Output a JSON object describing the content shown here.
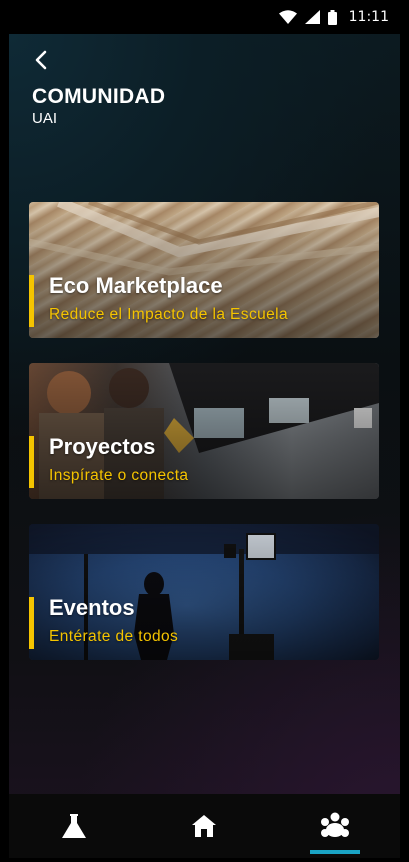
{
  "status_bar": {
    "time": "11:11",
    "icons": [
      "wifi-icon",
      "signal-icon",
      "battery-icon"
    ]
  },
  "header": {
    "title": "COMUNIDAD",
    "subtitle": "UAI",
    "back_icon": "chevron-left-icon"
  },
  "cards": [
    {
      "title": "Eco Marketplace",
      "subtitle": "Reduce el Impacto de la Escuela"
    },
    {
      "title": "Proyectos",
      "subtitle": "Inspírate o conecta"
    },
    {
      "title": "Eventos",
      "subtitle": "Entérate de todos"
    }
  ],
  "bottom_nav": {
    "items": [
      {
        "icon": "flask-icon"
      },
      {
        "icon": "home-icon"
      },
      {
        "icon": "community-icon",
        "active": true
      }
    ]
  },
  "colors": {
    "accent": "#f5c400",
    "active_tab": "#1aa3c4"
  }
}
